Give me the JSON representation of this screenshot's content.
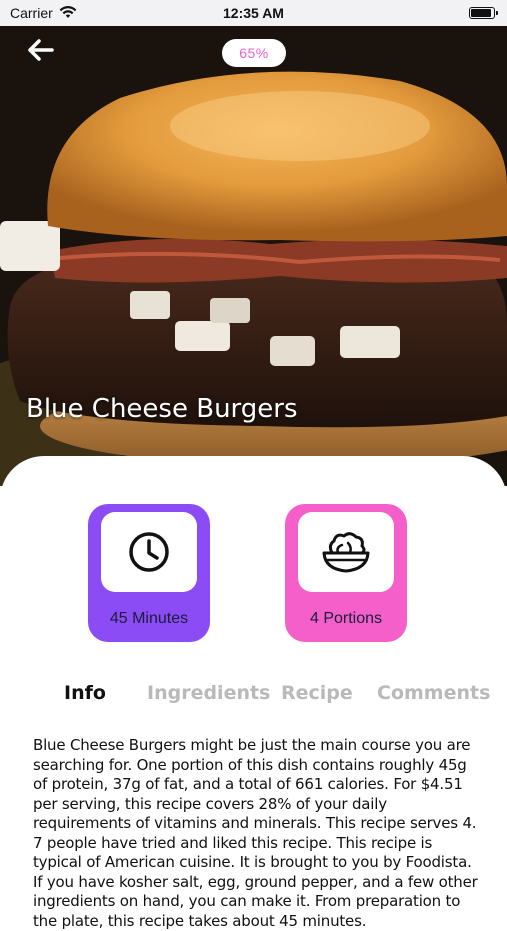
{
  "status_bar": {
    "carrier": "Carrier",
    "time": "12:35 AM"
  },
  "header": {
    "progress_label": "65%",
    "progress_value": 65,
    "recipe_title": "Blue Cheese Burgers"
  },
  "stats": {
    "time_label": "45 Minutes",
    "portions_label": "4 Portions"
  },
  "tabs": [
    {
      "label": "Info",
      "active": true
    },
    {
      "label": "Ingredients",
      "active": false
    },
    {
      "label": "Recipe",
      "active": false
    },
    {
      "label": "Comments",
      "active": false
    }
  ],
  "description": "Blue Cheese Burgers might be just the main course you are searching for. One portion of this dish contains roughly 45g of protein, 37g of fat, and a total of 661 calories. For $4.51 per serving, this recipe covers 28% of your daily requirements of vitamins and minerals. This recipe serves 4. 7 people have tried and liked this recipe. This recipe is typical of American cuisine. It is brought to you by Foodista. If you have kosher salt, egg, ground pepper, and a few other ingredients on hand, you can make it. From preparation to the plate, this recipe takes about 45 minutes.",
  "colors": {
    "time_card": "#8b4cf6",
    "portions_card": "#f45fc9",
    "progress_text": "#ec5fcf",
    "inactive_tab": "#b9b9b9"
  },
  "icons": {
    "back": "arrow-left-icon",
    "wifi": "wifi-icon",
    "battery": "battery-icon",
    "time": "clock-icon",
    "portions": "salad-bowl-icon"
  }
}
